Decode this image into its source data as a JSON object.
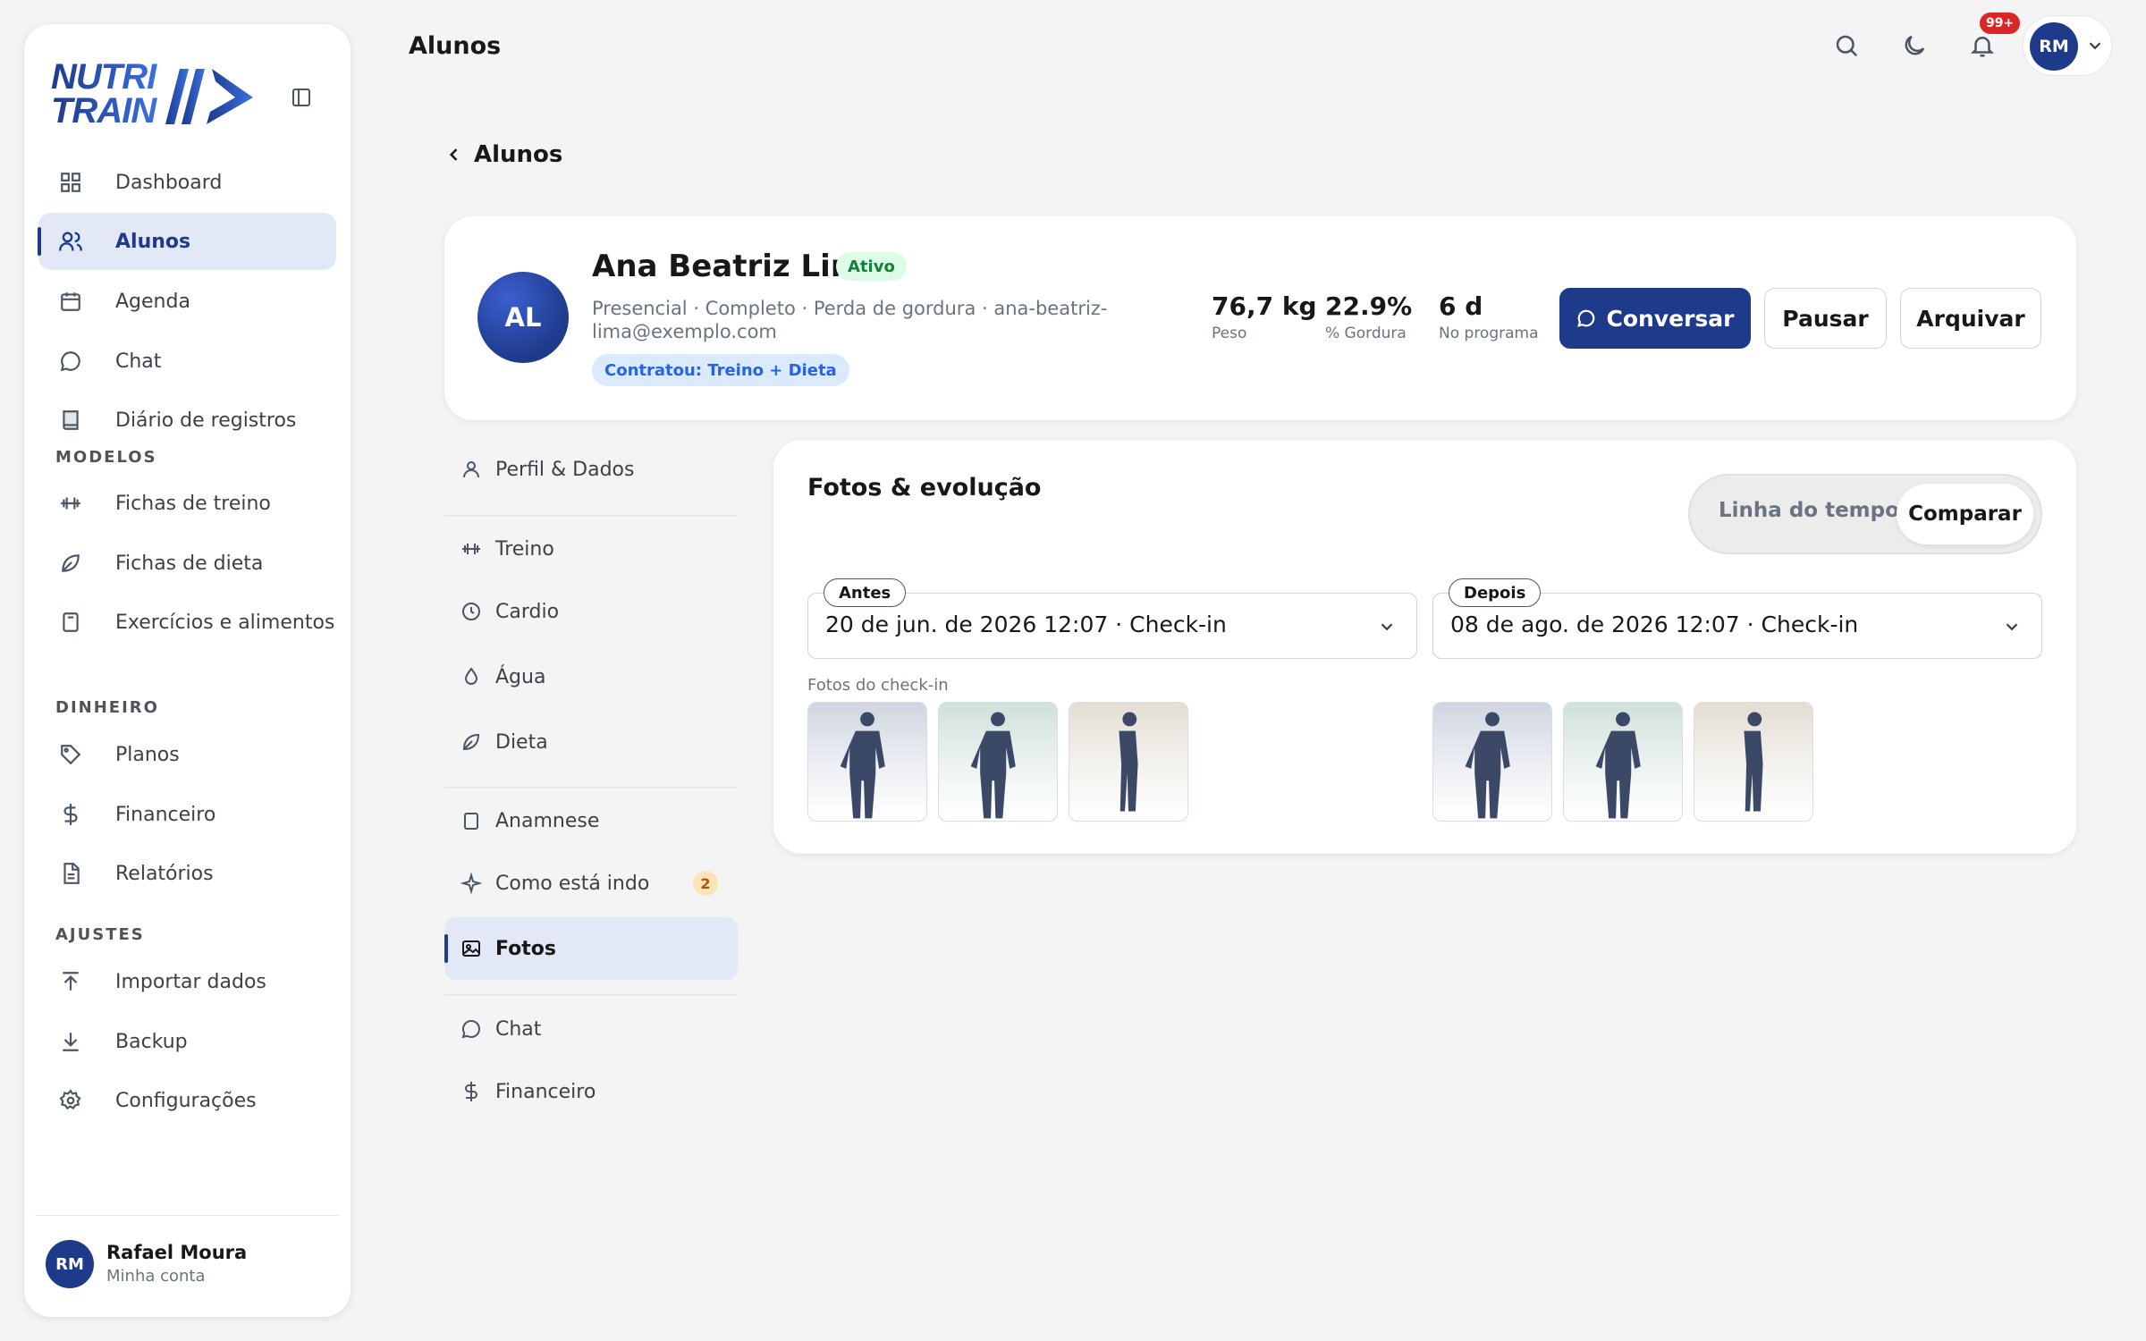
{
  "sidebar": {
    "brand": "NUTRITRAIN",
    "nav": [
      {
        "label": "Dashboard",
        "icon": "dashboard-icon",
        "active": false
      },
      {
        "label": "Alunos",
        "icon": "users-icon",
        "active": true
      },
      {
        "label": "Agenda",
        "icon": "calendar-icon",
        "active": false
      },
      {
        "label": "Chat",
        "icon": "chat-icon",
        "active": false
      },
      {
        "label": "Diário de registros",
        "icon": "book-icon",
        "active": false
      }
    ],
    "modelos_label": "MODELOS",
    "modelos": [
      {
        "label": "Fichas de treino",
        "icon": "dumbbell-icon"
      },
      {
        "label": "Fichas de dieta",
        "icon": "leaf-icon"
      },
      {
        "label": "Exercícios e alimentos",
        "icon": "clipboard-icon"
      }
    ],
    "dinheiro_label": "DINHEIRO",
    "dinheiro": [
      {
        "label": "Planos",
        "icon": "tag-icon"
      },
      {
        "label": "Financeiro",
        "icon": "dollar-icon"
      },
      {
        "label": "Relatórios",
        "icon": "report-icon"
      }
    ],
    "ajustes_label": "AJUSTES",
    "ajustes": [
      {
        "label": "Importar dados",
        "icon": "upload-icon"
      },
      {
        "label": "Backup",
        "icon": "download-icon"
      },
      {
        "label": "Configurações",
        "icon": "gear-icon"
      }
    ],
    "user": {
      "initials": "RM",
      "name": "Rafael Moura",
      "subtitle": "Minha conta"
    }
  },
  "topbar": {
    "title": "Alunos",
    "notifications": "99+",
    "user_initials": "RM"
  },
  "back_label": "Alunos",
  "profile": {
    "initials": "AL",
    "name": "Ana Beatriz Lima",
    "status": "Ativo",
    "meta": "Presencial · Completo · Perda de gordura · ana-beatriz-lima@exemplo.com",
    "contract": "Contratou: Treino + Dieta",
    "stats": [
      {
        "value": "76,7 kg",
        "label": "Peso"
      },
      {
        "value": "22.9%",
        "label": "% Gordura"
      },
      {
        "value": "6 d",
        "label": "No programa"
      }
    ],
    "actions": {
      "chat": "Conversar",
      "pause": "Pausar",
      "archive": "Arquivar"
    }
  },
  "subnav": [
    {
      "label": "Perfil & Dados",
      "icon": "user-icon"
    },
    {
      "label": "Treino",
      "icon": "dumbbell-icon"
    },
    {
      "label": "Cardio",
      "icon": "clock-icon"
    },
    {
      "label": "Água",
      "icon": "drop-icon"
    },
    {
      "label": "Dieta",
      "icon": "leaf-icon"
    },
    {
      "label": "Anamnese",
      "icon": "clipboard-icon"
    },
    {
      "label": "Como está indo",
      "icon": "sparkle-icon",
      "count": "2"
    },
    {
      "label": "Fotos",
      "icon": "image-icon",
      "active": true
    },
    {
      "label": "Chat",
      "icon": "chat-icon"
    },
    {
      "label": "Financeiro",
      "icon": "dollar-icon"
    }
  ],
  "photos": {
    "title": "Fotos & evolução",
    "view_toggle": {
      "timeline": "Linha do tempo",
      "compare": "Comparar",
      "selected": "Comparar"
    },
    "before": {
      "tag": "Antes",
      "value": "20 de jun. de 2026 12:07 · Check-in"
    },
    "after": {
      "tag": "Depois",
      "value": "08 de ago. de 2026 12:07 · Check-in"
    },
    "checkin_label": "Fotos do check-in",
    "thumb_colors": [
      "#cfd5e1",
      "#cfe0db",
      "#e3ddd3"
    ],
    "figure_color": "#3b4866"
  }
}
